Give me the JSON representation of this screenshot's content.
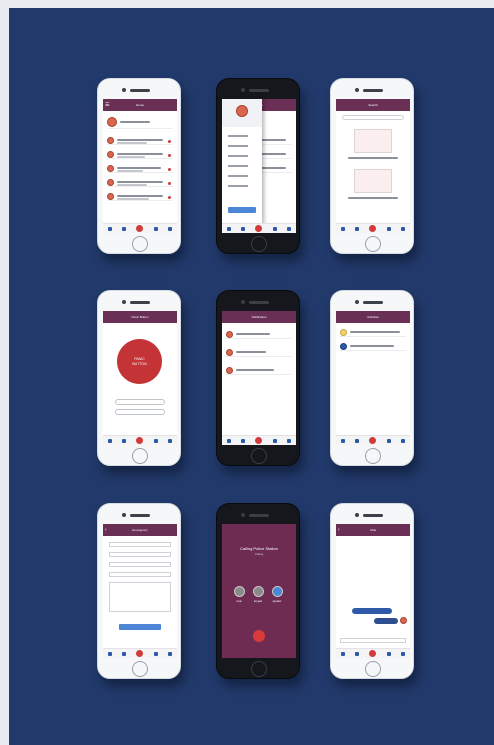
{
  "screens": [
    {
      "title": "Home"
    },
    {
      "title": "Menu"
    },
    {
      "title": "Search"
    },
    {
      "title": "Panic Button",
      "sos_line1": "PANIC",
      "sos_line2": "BUTTON"
    },
    {
      "title": "Notification"
    },
    {
      "title": "Activities"
    },
    {
      "title": "Emergency"
    },
    {
      "title": "Call",
      "call_name": "Calling Police Station",
      "call_status": "calling",
      "btn_mute": "mute",
      "btn_keypad": "keypad",
      "btn_speaker": "speaker"
    },
    {
      "title": "Chat"
    }
  ],
  "colors": {
    "background": "#223a6b",
    "brand": "#6a2f55",
    "accent": "#2d5aa8",
    "sos": "#c43436"
  }
}
